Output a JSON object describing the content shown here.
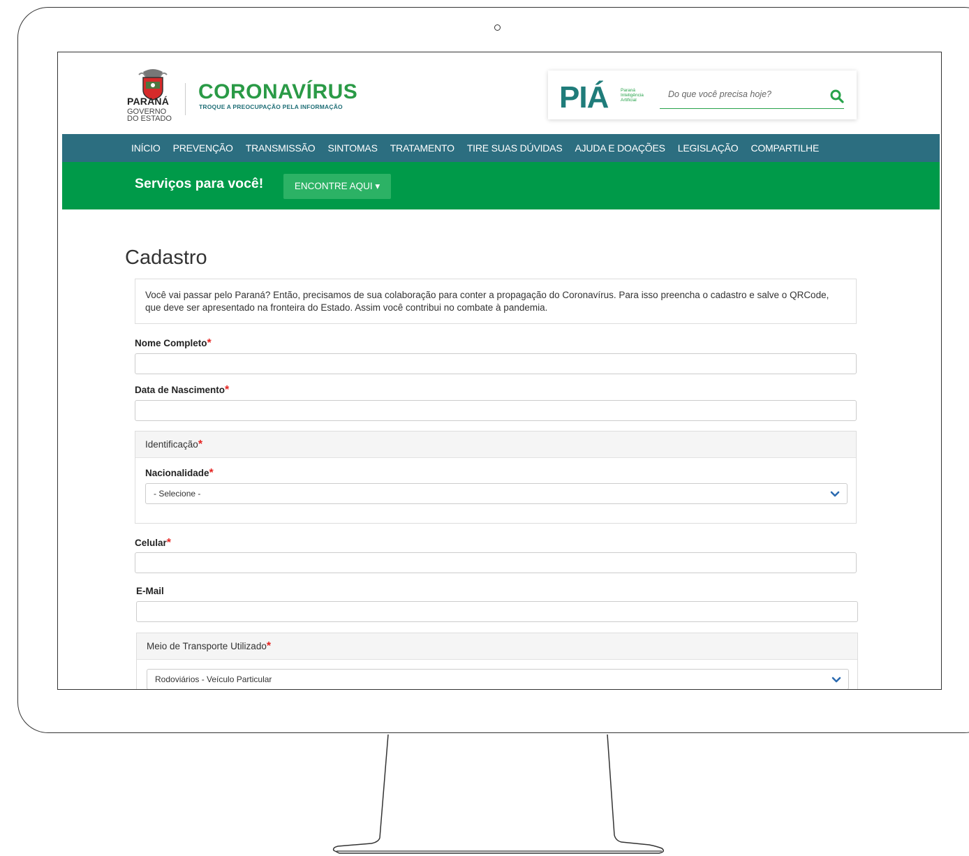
{
  "header": {
    "state_name": "PARANÁ",
    "state_sub1": "GOVERNO",
    "state_sub2": "DO ESTADO",
    "campaign_title": "CORONAVÍRUS",
    "campaign_subtitle": "TROQUE A PREOCUPAÇÃO PELA INFORMAÇÃO",
    "pia_logo": "PIÁ",
    "pia_tag1": "Paraná",
    "pia_tag2": "Inteligência",
    "pia_tag3": "Artificial",
    "search_placeholder": "Do que você precisa hoje?"
  },
  "nav": {
    "items": [
      "INÍCIO",
      "PREVENÇÃO",
      "TRANSMISSÃO",
      "SINTOMAS",
      "TRATAMENTO",
      "TIRE SUAS DÚVIDAS",
      "AJUDA E DOAÇÕES",
      "LEGISLAÇÃO",
      "COMPARTILHE"
    ]
  },
  "services": {
    "title": "Serviços para você!",
    "button": "ENCONTRE AQUI ▾"
  },
  "form": {
    "title": "Cadastro",
    "notice": "Você vai passar pelo Paraná? Então, precisamos de sua colaboração para conter a propagação do Coronavírus. Para isso preencha o cadastro e salve o QRCode, que deve ser apresentado na fronteira do Estado. Assim você contribui no combate à pandemia.",
    "required_mark": "*",
    "name_label": "Nome Completo",
    "birth_label": "Data de Nascimento",
    "identification_title": "Identificação",
    "nationality_label": "Nacionalidade",
    "nationality_value": "- Selecione -",
    "phone_label": "Celular",
    "email_label": "E-Mail",
    "transport_title": "Meio de Transporte Utilizado",
    "transport_value": "Rodoviários - Veículo Particular"
  },
  "colors": {
    "nav_bg": "#2c6e80",
    "services_bg": "#009a49",
    "brand_green": "#2a9a46",
    "required": "#e52421"
  }
}
